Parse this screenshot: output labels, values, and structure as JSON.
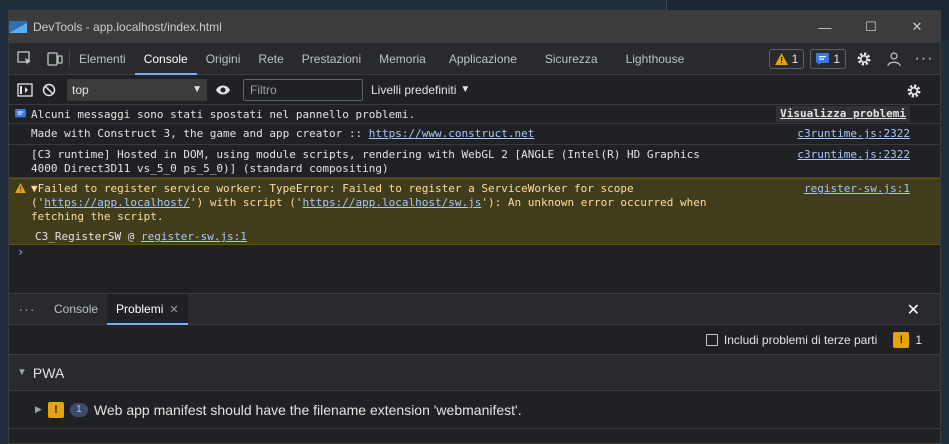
{
  "window": {
    "title": "DevTools - app.localhost/index.html",
    "controls": {
      "minimize": "—",
      "maximize": "☐",
      "close": "✕"
    }
  },
  "tabs": [
    "Elementi",
    "Console",
    "Origini",
    "Rete",
    "Prestazioni",
    "Memoria",
    "Applicazione",
    "Sicurezza",
    "Lighthouse"
  ],
  "tabs_active": "Console",
  "badges": {
    "warnings": "1",
    "messages": "1"
  },
  "toolbar": {
    "context": "top",
    "filter_placeholder": "Filtro",
    "levels": "Livelli predefiniti"
  },
  "console": {
    "info_message": "Alcuni messaggi sono stati spostati nel pannello problemi.",
    "info_button": "Visualizza problemi",
    "msg1_text": "Made with Construct 3, the game and app creator :: ",
    "msg1_link": "https://www.construct.net",
    "msg1_src": "c3runtime.js:2322",
    "msg2_text": "[C3 runtime] Hosted in DOM, using module scripts, rendering with WebGL 2 [ANGLE (Intel(R) HD Graphics 4000 Direct3D11 vs_5_0 ps_5_0)] (standard compositing)",
    "msg2_src": "c3runtime.js:2322",
    "warn_prefix": "▼Failed to register service worker:  TypeError: Failed to register a ServiceWorker for scope ('",
    "warn_link1": "https://app.localhost/",
    "warn_mid": "') with script ('",
    "warn_link2": "https://app.localhost/sw.js",
    "warn_suffix": "'): An unknown error occurred when fetching the script.",
    "warn_src": "register-sw.js:1",
    "stack_fn": "C3_RegisterSW @ ",
    "stack_link": "register-sw.js:1",
    "prompt": "›"
  },
  "drawer": {
    "tabs": [
      "Console",
      "Problemi"
    ],
    "active": "Problemi",
    "third_party_label": "Includi problemi di terze parti",
    "issue_count": "1",
    "group": "PWA",
    "issue_count_pill": "1",
    "issue_text": "Web app manifest should have the filename extension 'webmanifest'."
  },
  "colors": {
    "accent": "#7cacf8",
    "warning": "#e5a50a",
    "link": "#a8c7fa"
  }
}
